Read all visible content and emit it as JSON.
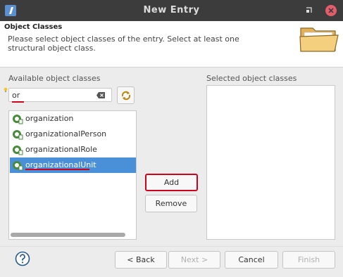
{
  "window": {
    "title": "New Entry"
  },
  "header": {
    "title": "Object Classes",
    "description": "Please select object classes of the entry. Select at least one structural object class."
  },
  "available": {
    "label": "Available object classes",
    "filter_value": "or",
    "items": [
      {
        "label": "organization",
        "selected": false
      },
      {
        "label": "organizationalPerson",
        "selected": false
      },
      {
        "label": "organizationalRole",
        "selected": false
      },
      {
        "label": "organizationalUnit",
        "selected": true
      }
    ]
  },
  "selected": {
    "label": "Selected object classes",
    "items": []
  },
  "actions": {
    "add_label": "Add",
    "remove_label": "Remove"
  },
  "footer": {
    "back_label": "< Back",
    "next_label": "Next >",
    "cancel_label": "Cancel",
    "finish_label": "Finish"
  },
  "colors": {
    "accent": "#4a90d9",
    "highlight": "#d0021b",
    "titlebar": "#3c3c3c"
  }
}
